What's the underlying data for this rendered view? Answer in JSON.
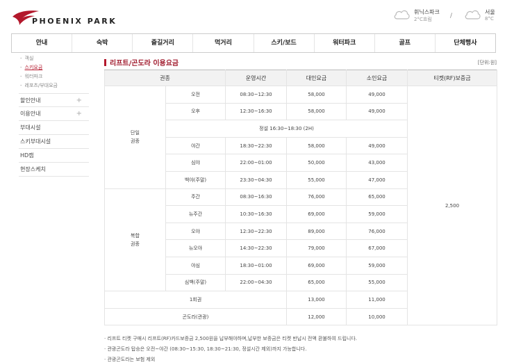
{
  "header": {
    "logo_text": "PHOENIX PARK",
    "weather": [
      {
        "name": "휘닉스파크",
        "temp": "2°C흐림"
      },
      {
        "name": "서울",
        "temp": "8°C"
      }
    ],
    "weather_separator": "/"
  },
  "nav": [
    "안내",
    "숙박",
    "즐길거리",
    "먹거리",
    "스키/보드",
    "워터파크",
    "골프",
    "단체행사"
  ],
  "sidebar": {
    "sub_items": [
      {
        "label": "객실",
        "active": false
      },
      {
        "label": "스키요금",
        "active": true
      },
      {
        "label": "워터파크",
        "active": false
      },
      {
        "label": "레포츠/부대요금",
        "active": false
      }
    ],
    "items": [
      {
        "label": "할인안내",
        "plus": "+"
      },
      {
        "label": "이용안내",
        "plus": "+"
      },
      {
        "label": "부대시설",
        "plus": ""
      },
      {
        "label": "스키부대시설",
        "plus": ""
      },
      {
        "label": "HD캠",
        "plus": ""
      },
      {
        "label": "현장스케치",
        "plus": ""
      }
    ]
  },
  "content": {
    "title": "리프트/곤도라 이용요금",
    "unit": "[단위:원]",
    "headers": [
      "권종",
      "운영시간",
      "대인요금",
      "소인요금",
      "티켓(RF)보증금"
    ],
    "deposit": "2,500",
    "groups": [
      {
        "name": "단일\n권종",
        "rows": [
          {
            "type": "오전",
            "time": "08:30~12:30",
            "adult": "58,000",
            "child": "49,000"
          },
          {
            "type": "오후",
            "time": "12:30~16:30",
            "adult": "58,000",
            "child": "49,000"
          },
          {
            "note": "정설 16:30~18:30 (2H)"
          },
          {
            "type": "야간",
            "time": "18:30~22:30",
            "adult": "58,000",
            "child": "49,000"
          },
          {
            "type": "심야",
            "time": "22:00~01:00",
            "adult": "50,000",
            "child": "43,000"
          },
          {
            "type": "백야(주말)",
            "time": "23:30~04:30",
            "adult": "55,000",
            "child": "47,000"
          }
        ]
      },
      {
        "name": "복합\n권종",
        "rows": [
          {
            "type": "주간",
            "time": "08:30~16:30",
            "adult": "76,000",
            "child": "65,000"
          },
          {
            "type": "뉴주간",
            "time": "10:30~16:30",
            "adult": "69,000",
            "child": "59,000"
          },
          {
            "type": "오야",
            "time": "12:30~22:30",
            "adult": "89,000",
            "child": "76,000"
          },
          {
            "type": "뉴오야",
            "time": "14:30~22:30",
            "adult": "79,000",
            "child": "67,000"
          },
          {
            "type": "야심",
            "time": "18:30~01:00",
            "adult": "69,000",
            "child": "59,000"
          },
          {
            "type": "심백(주말)",
            "time": "22:00~04:30",
            "adult": "65,000",
            "child": "55,000"
          }
        ]
      }
    ],
    "extra_rows": [
      {
        "type": "1회권",
        "adult": "13,000",
        "child": "11,000"
      },
      {
        "type": "곤도라(관광)",
        "adult": "12,000",
        "child": "10,000"
      }
    ]
  },
  "notes": [
    "리프트 티켓 구매시 리프트(RF)카드보증금 2,500원을 납부해야하며,납부한 보증금은 티켓 반납시 전액 환불하여 드립니다.",
    "관광곤도라 탑승은 오전~야간 (08:30~15:30, 18:30~21:30, 정설시간 제외)까지 가능합니다.",
    "관광곤도라는 보험 제외"
  ],
  "colors": {
    "accent": "#b3182c",
    "title": "#a01a2c",
    "header_bg": "#f2f2f2"
  }
}
